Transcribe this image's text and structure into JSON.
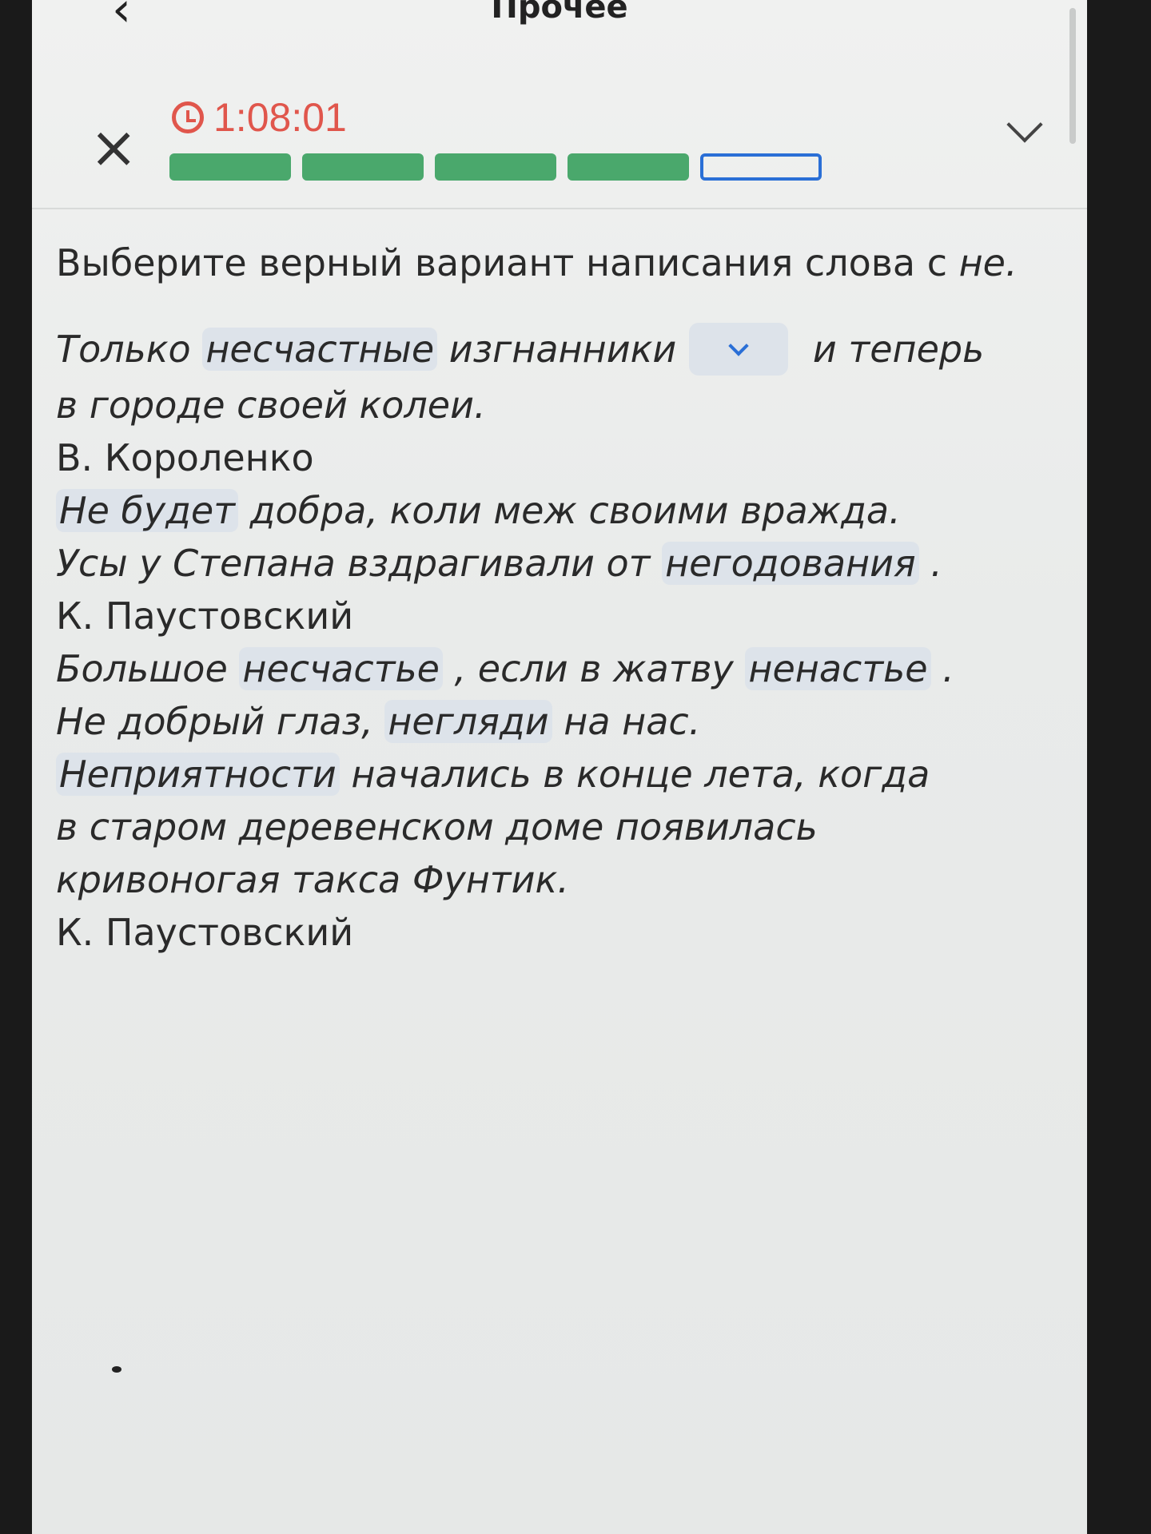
{
  "topbar": {
    "title": "Прочее"
  },
  "header": {
    "timer": "1:08:01",
    "progress": {
      "total": 5,
      "completed": 4,
      "current": 5
    },
    "colors": {
      "timer": "#e0564c",
      "done": "#4aa86c",
      "current": "#2a6fd6"
    }
  },
  "task": {
    "instruction_main": "Выберите верный вариант написания слова с ",
    "instruction_tail": "не."
  },
  "lines": [
    {
      "parts": [
        "Только ",
        "несчастные",
        " изгнанники",
        " и теперь"
      ]
    },
    {
      "parts": [
        "в городе своей колеи."
      ]
    },
    {
      "parts": [
        "В. Короленко"
      ]
    },
    {
      "parts": [
        "Не будет",
        " добра, коли меж своими вражда."
      ]
    },
    {
      "parts": [
        "Усы у Степана вздрагивали от ",
        "негодования",
        " ."
      ]
    },
    {
      "parts": [
        "К. Паустовский"
      ]
    },
    {
      "parts": [
        "Большое ",
        "несчастье",
        " , если в жатву ",
        "ненастье",
        " ."
      ]
    },
    {
      "parts": [
        "Не добрый глаз, ",
        "негляди",
        " на нас."
      ]
    },
    {
      "parts": [
        "Неприятности",
        " начались в конце лета, когда"
      ]
    },
    {
      "parts": [
        "в старом деревенском доме появилась"
      ]
    },
    {
      "parts": [
        "кривоногая такса Фунтик."
      ]
    },
    {
      "parts": [
        "К. Паустовский"
      ]
    }
  ]
}
